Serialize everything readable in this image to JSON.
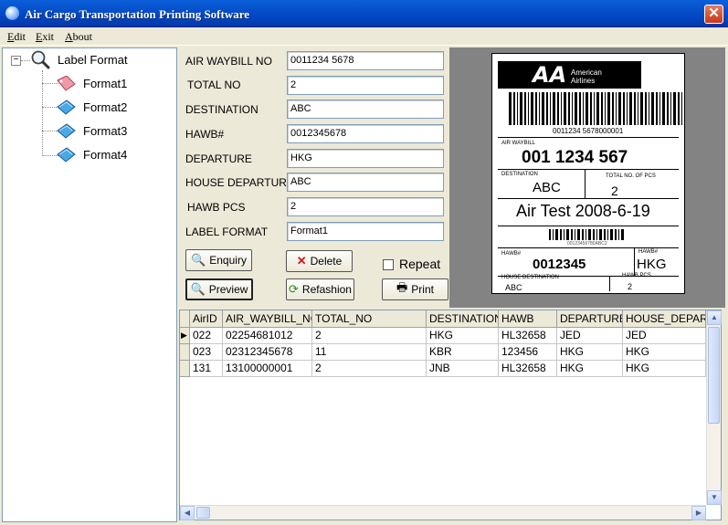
{
  "window": {
    "title": "Air Cargo Transportation  Printing Software",
    "close": "✕"
  },
  "menu": [
    {
      "underline": "E",
      "rest": "dit"
    },
    {
      "underline": "E",
      "rest": "xit"
    },
    {
      "underline": "A",
      "rest": "bout"
    }
  ],
  "tree": {
    "expander": "−",
    "root": "Label Format",
    "items": [
      "Format1",
      "Format2",
      "Format3",
      "Format4"
    ]
  },
  "form": {
    "fields": [
      {
        "label": "AIR WAYBILL NO",
        "value": "0011234 5678"
      },
      {
        "label": "TOTAL NO",
        "value": "2"
      },
      {
        "label": "DESTINATION",
        "value": "ABC"
      },
      {
        "label": "HAWB#",
        "value": "0012345678"
      },
      {
        "label": "DEPARTURE",
        "value": "HKG"
      },
      {
        "label": "HOUSE DEPARTURE",
        "value": "ABC"
      },
      {
        "label": "HAWB PCS",
        "value": "2"
      },
      {
        "label": "LABEL FORMAT",
        "value": "Format1"
      }
    ],
    "buttons": {
      "enquiry": "Enquiry",
      "delete": "Delete",
      "preview": "Preview",
      "refashion": "Refashion",
      "print": "Print"
    },
    "repeat_label": "Repeat"
  },
  "label": {
    "logo_mark": "AA",
    "logo_line1": "American",
    "logo_line2": "Airlines",
    "barcode_text": "0011234 5678000001",
    "airwaybill_caption": "AIR WAYBILL",
    "airwaybill_value": "001 1234  567",
    "destination_caption": "DESTINATION",
    "destination_value": "ABC",
    "total_caption": "TOTAL NO. OF PCS",
    "total_value": "2",
    "test_line": "Air Test 2008-6-19",
    "small_barcode_text": "00123456780ABC2",
    "hawb_caption": "HAWB#",
    "hawb_value": "0012345",
    "hawb_dest_caption": "HAWB#",
    "hawb_dest_value": "HKG",
    "house_dest_caption": "HOUSE DESTINATION",
    "house_dest_value": "ABC",
    "hawb_pcs_caption": "HAWB PCS",
    "hawb_pcs_value": "2"
  },
  "grid": {
    "columns": [
      "AirID",
      "AIR_WAYBILL_NO",
      "TOTAL_NO",
      "DESTINATION",
      "HAWB",
      "DEPARTURE",
      "HOUSE_DEPART"
    ],
    "rows": [
      [
        "022",
        "02254681012",
        "2",
        "HKG",
        "HL32658",
        "JED",
        "JED"
      ],
      [
        "023",
        "02312345678",
        "11",
        "KBR",
        "123456",
        "HKG",
        "HKG"
      ],
      [
        "131",
        "13100000001",
        "2",
        "JNB",
        "HL32658",
        "HKG",
        "HKG"
      ]
    ],
    "selected_row": 0
  }
}
